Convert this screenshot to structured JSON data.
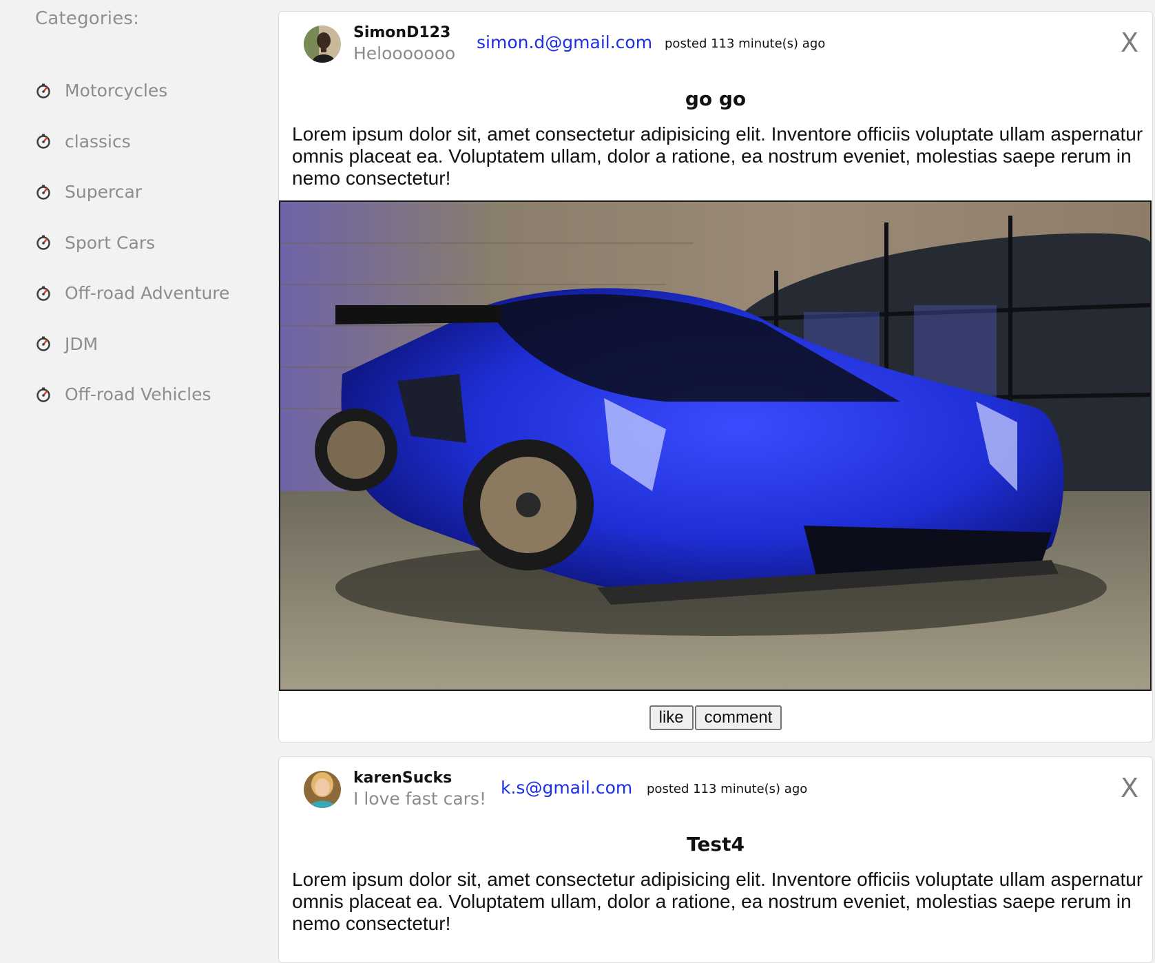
{
  "sidebar": {
    "heading": "Categories:",
    "items": [
      {
        "label": "Motorcycles",
        "icon": "gauge-icon"
      },
      {
        "label": "classics",
        "icon": "gauge-icon"
      },
      {
        "label": "Supercar",
        "icon": "gauge-icon"
      },
      {
        "label": "Sport Cars",
        "icon": "gauge-icon"
      },
      {
        "label": "Off-road Adventure",
        "icon": "gauge-icon"
      },
      {
        "label": "JDM",
        "icon": "gauge-icon"
      },
      {
        "label": "Off-road Vehicles",
        "icon": "gauge-icon"
      }
    ]
  },
  "posts": [
    {
      "username": "SimonD123",
      "bio": "Helooooooo",
      "email": "simon.d@gmail.com",
      "posted": "posted 113 minute(s) ago",
      "close_label": "X",
      "title": "go go",
      "body": "Lorem ipsum dolor sit, amet consectetur adipisicing elit. Inventore officiis voluptate ullam aspernatur omnis placeat ea. Voluptatem ullam, dolor a ratione, ea nostrum eveniet, molestias saepe rerum in nemo consectetur!",
      "image": "blue-supercar-photo",
      "like_label": "like",
      "comment_label": "comment"
    },
    {
      "username": "karenSucks",
      "bio": "I love fast cars!",
      "email": "k.s@gmail.com",
      "posted": "posted 113 minute(s) ago",
      "close_label": "X",
      "title": "Test4",
      "body": "Lorem ipsum dolor sit, amet consectetur adipisicing elit. Inventore officiis voluptate ullam aspernatur omnis placeat ea. Voluptatem ullam, dolor a ratione, ea nostrum eveniet, molestias saepe rerum in nemo consectetur!"
    }
  ],
  "colors": {
    "page_bg": "#f1f2f1",
    "email_link": "#1b2ee8",
    "sidebar_text": "#8d8d8d",
    "car_blue": "#1f2fd6"
  }
}
